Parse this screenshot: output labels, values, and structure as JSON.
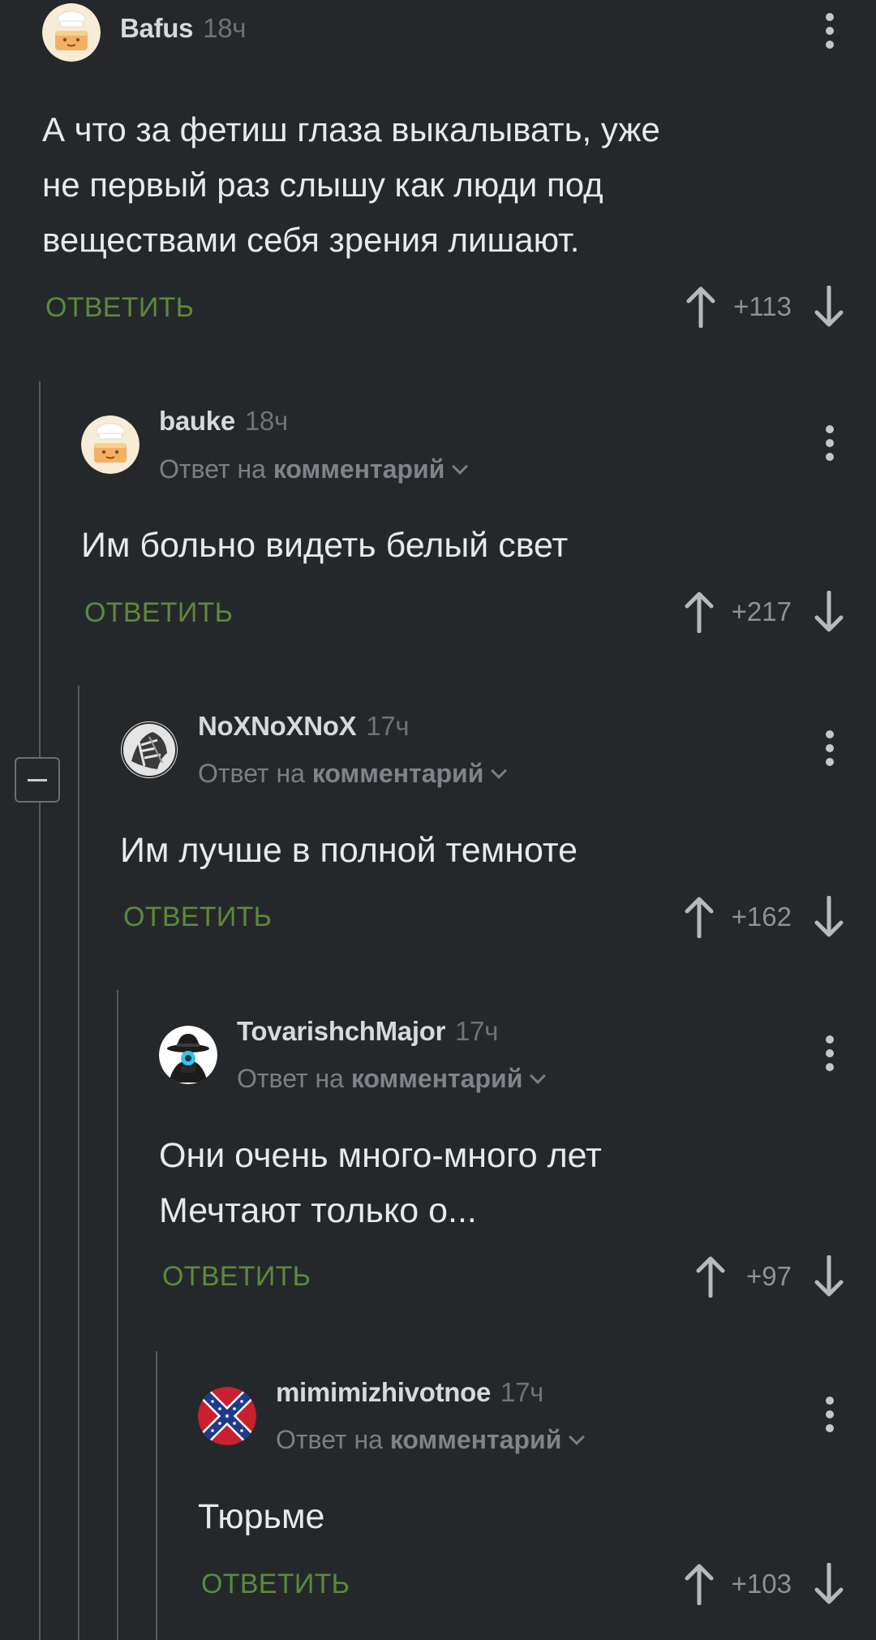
{
  "comments": [
    {
      "username": "Bafus",
      "time": "18ч",
      "reply_prefix": "",
      "reply_target": "",
      "body_lines": [
        "А что за фетиш глаза выкалывать, уже",
        "не первый раз слышу как люди под",
        "веществами себя зрения лишают."
      ],
      "reply_label": "ОТВЕТИТЬ",
      "score": "+113",
      "avatar": "chef-cake-avatar"
    },
    {
      "username": "bauke",
      "time": "18ч",
      "reply_prefix": "Ответ на",
      "reply_target": "комментарий",
      "body_lines": [
        "Им больно видеть белый свет"
      ],
      "reply_label": "ОТВЕТИТЬ",
      "score": "+217",
      "avatar": "chef-cake-avatar"
    },
    {
      "username": "NoXNoXNoX",
      "time": "17ч",
      "reply_prefix": "Ответ на",
      "reply_target": "комментарий",
      "body_lines": [
        "Им лучше в полной темноте"
      ],
      "reply_label": "ОТВЕТИТЬ",
      "score": "+162",
      "avatar": "sketch-face-avatar"
    },
    {
      "username": "TovarishchMajor",
      "time": "17ч",
      "reply_prefix": "Ответ на",
      "reply_target": "комментарий",
      "body_lines": [
        "Они очень много-много лет",
        "Мечтают только о..."
      ],
      "reply_label": "ОТВЕТИТЬ",
      "score": "+97",
      "avatar": "spy-hat-avatar"
    },
    {
      "username": "mimimizhivotnoe",
      "time": "17ч",
      "reply_prefix": "Ответ на",
      "reply_target": "комментарий",
      "body_lines": [
        "Тюрьме"
      ],
      "reply_label": "ОТВЕТИТЬ",
      "score": "+103",
      "avatar": "confederate-flag-avatar"
    }
  ],
  "colors": {
    "background": "#25282b",
    "reply_green": "#5b8a3c",
    "thread_line": "#55595d"
  }
}
